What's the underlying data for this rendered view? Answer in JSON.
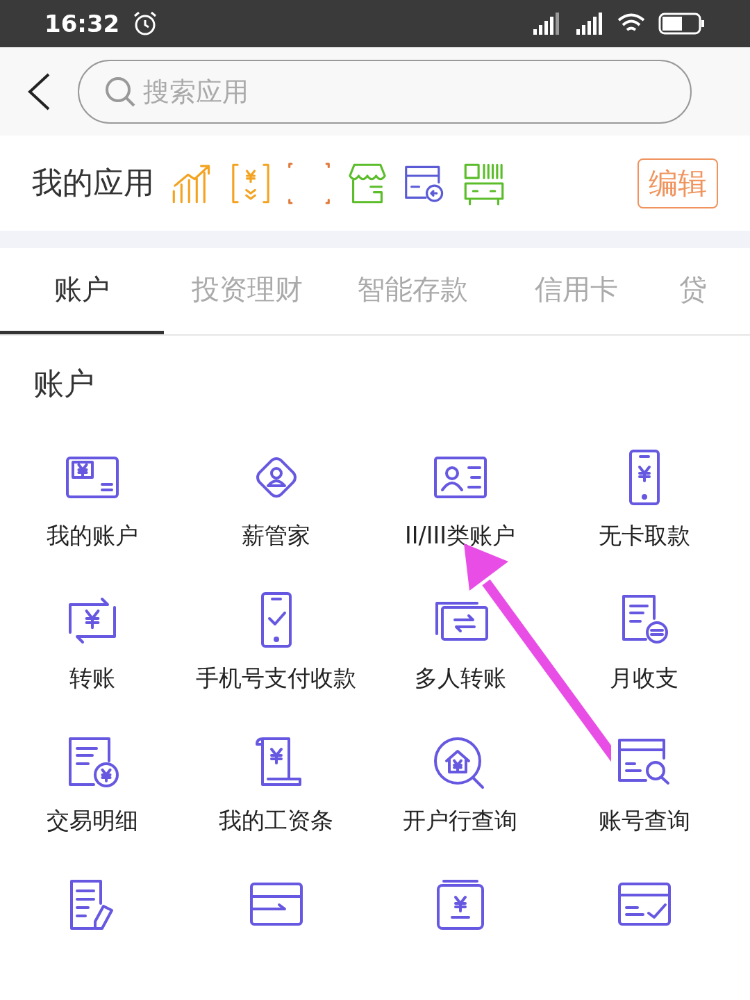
{
  "status_bar": {
    "time": "16:32"
  },
  "search": {
    "placeholder": "搜索应用"
  },
  "my_apps": {
    "title": "我的应用",
    "edit_button": "编辑"
  },
  "tabs": [
    {
      "label": "账户",
      "selected": true
    },
    {
      "label": "投资理财",
      "selected": false
    },
    {
      "label": "智能存款",
      "selected": false
    },
    {
      "label": "信用卡",
      "selected": false
    },
    {
      "label": "贷",
      "selected": false
    }
  ],
  "section": {
    "title": "账户"
  },
  "apps": [
    {
      "label": "我的账户"
    },
    {
      "label": "薪管家"
    },
    {
      "label": "II/III类账户"
    },
    {
      "label": "无卡取款"
    },
    {
      "label": "转账"
    },
    {
      "label": "手机号支付收款"
    },
    {
      "label": "多人转账"
    },
    {
      "label": "月收支"
    },
    {
      "label": "交易明细"
    },
    {
      "label": "我的工资条"
    },
    {
      "label": "开户行查询"
    },
    {
      "label": "账号查询"
    }
  ]
}
